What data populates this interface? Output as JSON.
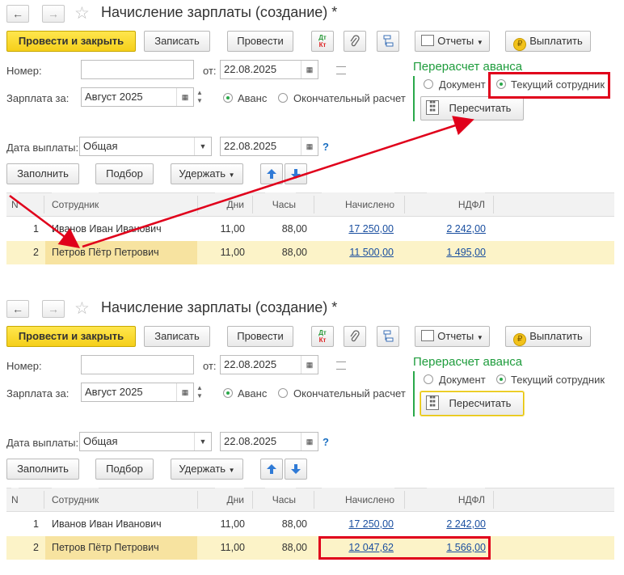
{
  "panels": [
    {
      "title": "Начисление зарплаты (создание) *",
      "toolbar": {
        "post_close": "Провести и закрыть",
        "save": "Записать",
        "post": "Провести",
        "dtkt_top": "Дт",
        "dtkt_bottom": "Кт",
        "reports": "Отчеты",
        "pay": "Выплатить"
      },
      "fields": {
        "number_label": "Номер:",
        "number_value": "",
        "date_label": "от:",
        "date_value": "22.08.2025",
        "salary_label": "Зарплата за:",
        "salary_value": "Август 2025",
        "advance": "Аванс",
        "final": "Окончательный расчет",
        "paydate_label": "Дата выплаты:",
        "paydate_type": "Общая",
        "paydate_value": "22.08.2025",
        "help": "?"
      },
      "recalc": {
        "title": "Перерасчет аванса",
        "opt_document": "Документ",
        "opt_current": "Текущий сотрудник",
        "button": "Пересчитать"
      },
      "buttons": {
        "fill": "Заполнить",
        "select": "Подбор",
        "withhold": "Удержать"
      },
      "table": {
        "headers": [
          "N",
          "Сотрудник",
          "Дни",
          "Часы",
          "Начислено",
          "НДФЛ"
        ],
        "rows": [
          {
            "n": "1",
            "employee": "Иванов Иван Иванович",
            "days": "11,00",
            "hours": "88,00",
            "accrued": "17 250,00",
            "ndfl": "2 242,00"
          },
          {
            "n": "2",
            "employee": "Петров Пётр Петрович",
            "days": "11,00",
            "hours": "88,00",
            "accrued": "11 500,00",
            "ndfl": "1 495,00"
          }
        ]
      }
    },
    {
      "title": "Начисление зарплаты (создание) *",
      "toolbar": {
        "post_close": "Провести и закрыть",
        "save": "Записать",
        "post": "Провести",
        "dtkt_top": "Дт",
        "dtkt_bottom": "Кт",
        "reports": "Отчеты",
        "pay": "Выплатить"
      },
      "fields": {
        "number_label": "Номер:",
        "number_value": "",
        "date_label": "от:",
        "date_value": "22.08.2025",
        "salary_label": "Зарплата за:",
        "salary_value": "Август 2025",
        "advance": "Аванс",
        "final": "Окончательный расчет",
        "paydate_label": "Дата выплаты:",
        "paydate_type": "Общая",
        "paydate_value": "22.08.2025",
        "help": "?"
      },
      "recalc": {
        "title": "Перерасчет аванса",
        "opt_document": "Документ",
        "opt_current": "Текущий сотрудник",
        "button": "Пересчитать"
      },
      "buttons": {
        "fill": "Заполнить",
        "select": "Подбор",
        "withhold": "Удержать"
      },
      "table": {
        "headers": [
          "N",
          "Сотрудник",
          "Дни",
          "Часы",
          "Начислено",
          "НДФЛ"
        ],
        "rows": [
          {
            "n": "1",
            "employee": "Иванов Иван Иванович",
            "days": "11,00",
            "hours": "88,00",
            "accrued": "17 250,00",
            "ndfl": "2 242,00"
          },
          {
            "n": "2",
            "employee": "Петров Пётр Петрович",
            "days": "11,00",
            "hours": "88,00",
            "accrued": "12 047,62",
            "ndfl": "1 566,00"
          }
        ]
      }
    }
  ],
  "colors": {
    "primary": "#f5cf1a",
    "accent_green": "#1e9c3c",
    "annotation_red": "#e0001b",
    "selected_row": "#fcf3c8"
  },
  "icons": [
    "back-arrow-icon",
    "forward-arrow-icon",
    "star-icon",
    "dt-kt-icon",
    "paperclip-icon",
    "structure-icon",
    "coin-icon",
    "calendar-icon",
    "spin-icon",
    "calculator-icon",
    "arrow-up-icon",
    "arrow-down-icon"
  ]
}
